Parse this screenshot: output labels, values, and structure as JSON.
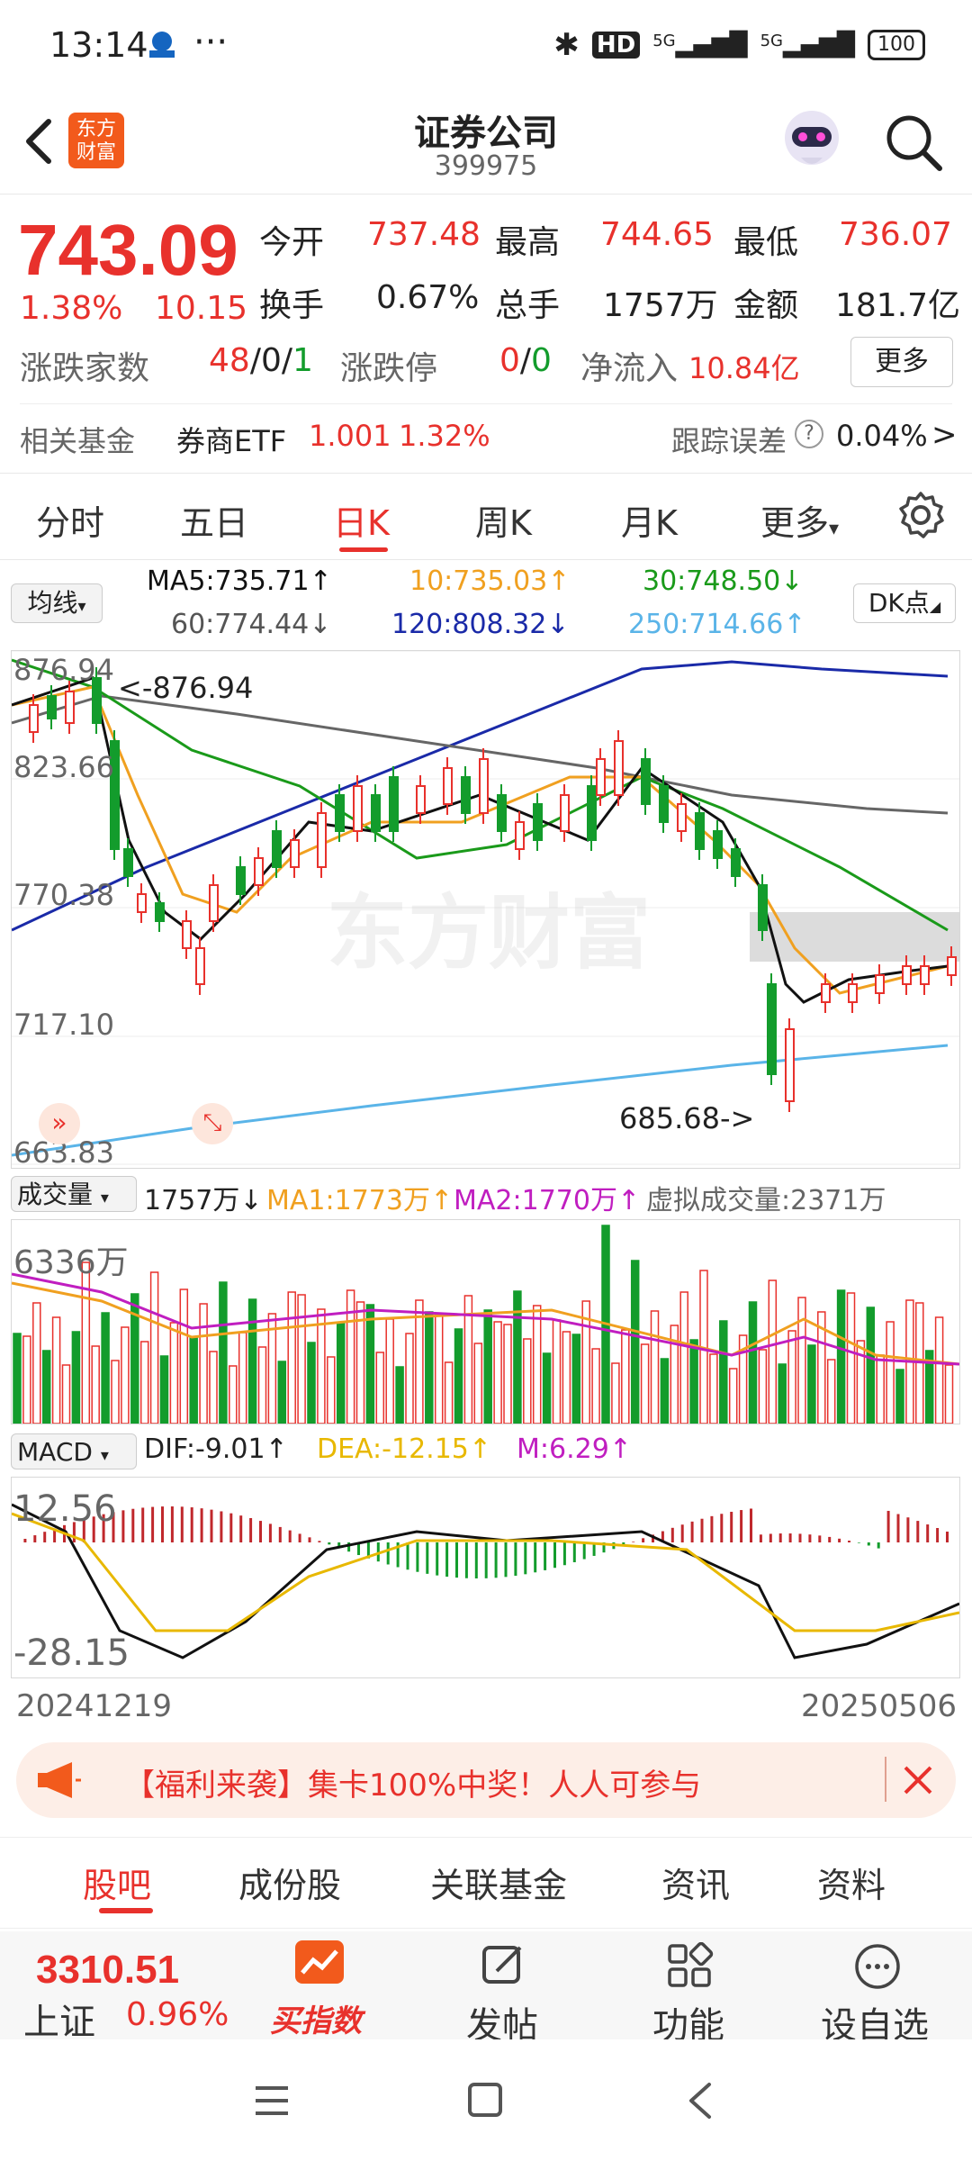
{
  "status": {
    "time": "13:14",
    "dots": "···",
    "battery": "100",
    "hd": "HD",
    "net1": "5G",
    "net2": "5G"
  },
  "header": {
    "title": "证券公司",
    "code": "399975",
    "logo": "东方财富"
  },
  "quote": {
    "price": "743.09",
    "change_pct": "1.38%",
    "change": "10.15",
    "open_label": "今开",
    "open": "737.48",
    "high_label": "最高",
    "high": "744.65",
    "low_label": "最低",
    "low": "736.07",
    "turnover_label": "换手",
    "turnover": "0.67%",
    "volume_label": "总手",
    "volume": "1757万",
    "amount_label": "金额",
    "amount": "181.7亿",
    "updown_label": "涨跌家数",
    "up": "48",
    "flat": "0",
    "down": "1",
    "sep": "/",
    "limit_label": "涨跌停",
    "limit_up": "0",
    "limit_down": "0",
    "inflow_label": "净流入",
    "inflow": "10.84亿",
    "more": "更多"
  },
  "fund": {
    "label": "相关基金",
    "name": "券商ETF",
    "price": "1.001",
    "pct": "1.32%",
    "track_label": "跟踪误差",
    "track": "0.04%",
    "help": "?",
    "arrow": ">"
  },
  "tabs": [
    "分时",
    "五日",
    "日K",
    "周K",
    "月K",
    "更多"
  ],
  "active_tab": "日K",
  "ma": {
    "selector": "均线",
    "ma5": "MA5:735.71↑",
    "ma10": "10:735.03↑",
    "ma30": "30:748.50↓",
    "ma60": "60:774.44↓",
    "ma120": "120:808.32↓",
    "ma250": "250:714.66↑",
    "dk": "DK点"
  },
  "kline": {
    "y_labels": [
      "876.94",
      "823.66",
      "770.38",
      "717.10",
      "663.83"
    ],
    "high_marker": "876.94",
    "low_marker": "685.68->",
    "watermark": "东方财富",
    "ma_colors": {
      "ma5": "#111111",
      "ma10": "#f0a020",
      "ma30": "#1a9a1a",
      "ma60": "#666666",
      "ma120": "#1a2aa8",
      "ma250": "#5ab4e8"
    }
  },
  "volume_panel": {
    "selector": "成交量",
    "vol": "1757万↓",
    "ma1": "MA1:1773万↑",
    "ma2": "MA2:1770万↑",
    "virtual": "虚拟成交量:2371万",
    "y_label": "6336万"
  },
  "macd": {
    "selector": "MACD",
    "dif": "DIF:-9.01↑",
    "dea": "DEA:-12.15↑",
    "m": "M:6.29↑",
    "y_top": "12.56",
    "y_bottom": "-28.15"
  },
  "dates": {
    "start": "20241219",
    "end": "20250506"
  },
  "banner": {
    "text": "【福利来袭】集卡100%中奖！人人可参与"
  },
  "bottom_tabs": [
    "股吧",
    "成份股",
    "关联基金",
    "资讯",
    "资料"
  ],
  "toolbar": {
    "index_value": "3310.51",
    "index_name": "上证",
    "index_pct": "0.96%",
    "buy": "买指数",
    "post": "发帖",
    "func": "功能",
    "watch": "设自选"
  }
}
